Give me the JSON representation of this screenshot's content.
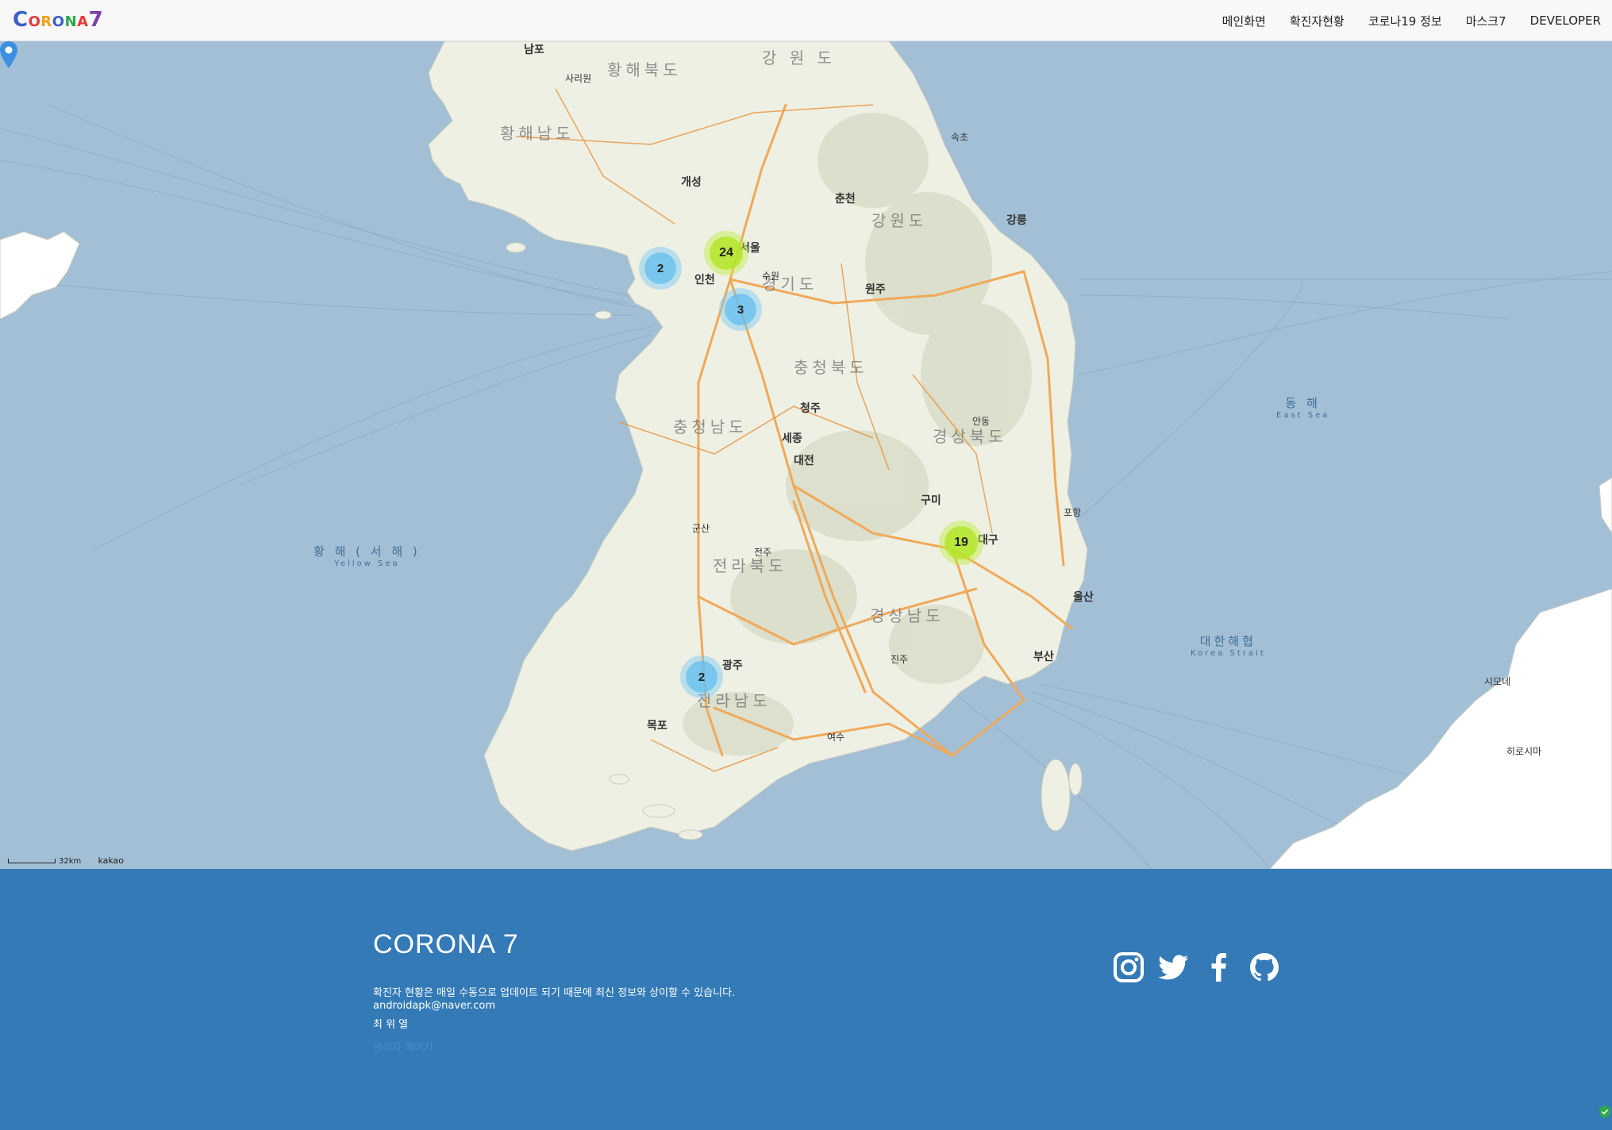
{
  "header": {
    "logo": {
      "text": "CORONA7",
      "letters": [
        "C",
        "O",
        "R",
        "O",
        "N",
        "A",
        "7"
      ],
      "colors": [
        "#3a5fc8",
        "#e43b3b",
        "#f0a019",
        "#3a5fc8",
        "#2da84a",
        "#e43b3b",
        "#7b3fa6"
      ]
    },
    "nav": [
      {
        "label": "메인화면"
      },
      {
        "label": "확진자현황"
      },
      {
        "label": "코로나19 정보"
      },
      {
        "label": "마스크7"
      },
      {
        "label": "DEVELOPER"
      }
    ]
  },
  "map": {
    "provider": "kakao",
    "scale_label": "32km",
    "clusters": [
      {
        "count": "24",
        "level": "green"
      },
      {
        "count": "2",
        "level": "blue"
      },
      {
        "count": "3",
        "level": "blue"
      },
      {
        "count": "19",
        "level": "green"
      },
      {
        "count": "2",
        "level": "blue"
      }
    ],
    "seas": [
      {
        "name": "황 해 ( 서 해 )",
        "en": "Yellow Sea"
      },
      {
        "name": "동 해",
        "en": "East Sea"
      },
      {
        "name": "대한해협",
        "en": "Korea Strait"
      }
    ],
    "provinces": [
      "강원도",
      "경기도",
      "충청북도",
      "충청남도",
      "경상북도",
      "전라북도",
      "경상남도",
      "전라남도",
      "황해북도",
      "황해남도",
      "강 원 도"
    ],
    "cities": [
      "서울",
      "인천",
      "개성",
      "수원",
      "춘천",
      "원주",
      "강릉",
      "세종",
      "대전",
      "청주",
      "구미",
      "대구",
      "울산",
      "부산",
      "광주",
      "목포",
      "군산",
      "전주",
      "포항",
      "진주",
      "안동",
      "남포",
      "여수",
      "사리원",
      "속초",
      "시모네",
      "히로시마"
    ],
    "accent_colors": {
      "water": "#a3bfd6",
      "land": "#eef0e4",
      "road": "#f0a95a",
      "highway": "#e8913a"
    }
  },
  "footer": {
    "title": "CORONA 7",
    "notice": "확진자 현황은 매일 수동으로 업데이트 되기 때문에 최신 정보와 상이할 수 있습니다.",
    "email": "androidapk@naver.com",
    "author": "최 위 열",
    "admin_link": "관리자 페이지",
    "social": [
      "instagram-icon",
      "twitter-icon",
      "facebook-icon",
      "github-icon"
    ],
    "background": "#337ab7"
  }
}
